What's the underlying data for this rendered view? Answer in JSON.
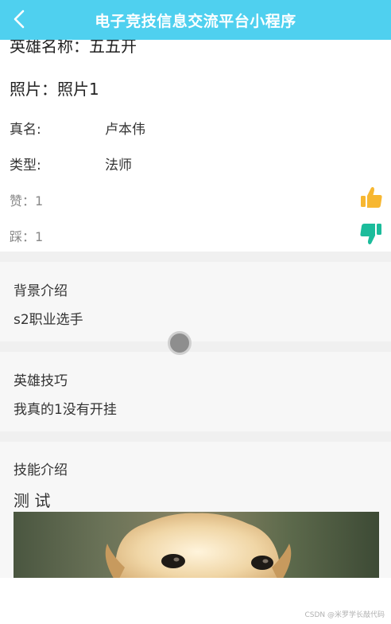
{
  "header": {
    "title": "电子竞技信息交流平台小程序"
  },
  "hero": {
    "name_line": "英雄名称：五五开",
    "photo_line": "照片：照片1"
  },
  "info": [
    {
      "label": "真名:",
      "value": "卢本伟"
    },
    {
      "label": "类型:",
      "value": "法师"
    }
  ],
  "votes": {
    "like_text": "赞：1",
    "dislike_text": "踩：1",
    "like_icon": "thumbs-up-icon",
    "dislike_icon": "thumbs-down-icon",
    "like_color": "#f7b731",
    "dislike_color": "#1bbc9b"
  },
  "sections": {
    "background": {
      "title": "背景介绍",
      "body": "s2职业选手"
    },
    "tips": {
      "title": "英雄技巧",
      "body": "我真的1没有开挂"
    },
    "skill": {
      "title": "技能介绍",
      "body": "测 试"
    }
  },
  "watermark": "CSDN @米罗学长敲代码",
  "colors": {
    "header": "#4fd0ef",
    "page_background": "#f7f7f7",
    "separator": "#f0f0f0"
  }
}
